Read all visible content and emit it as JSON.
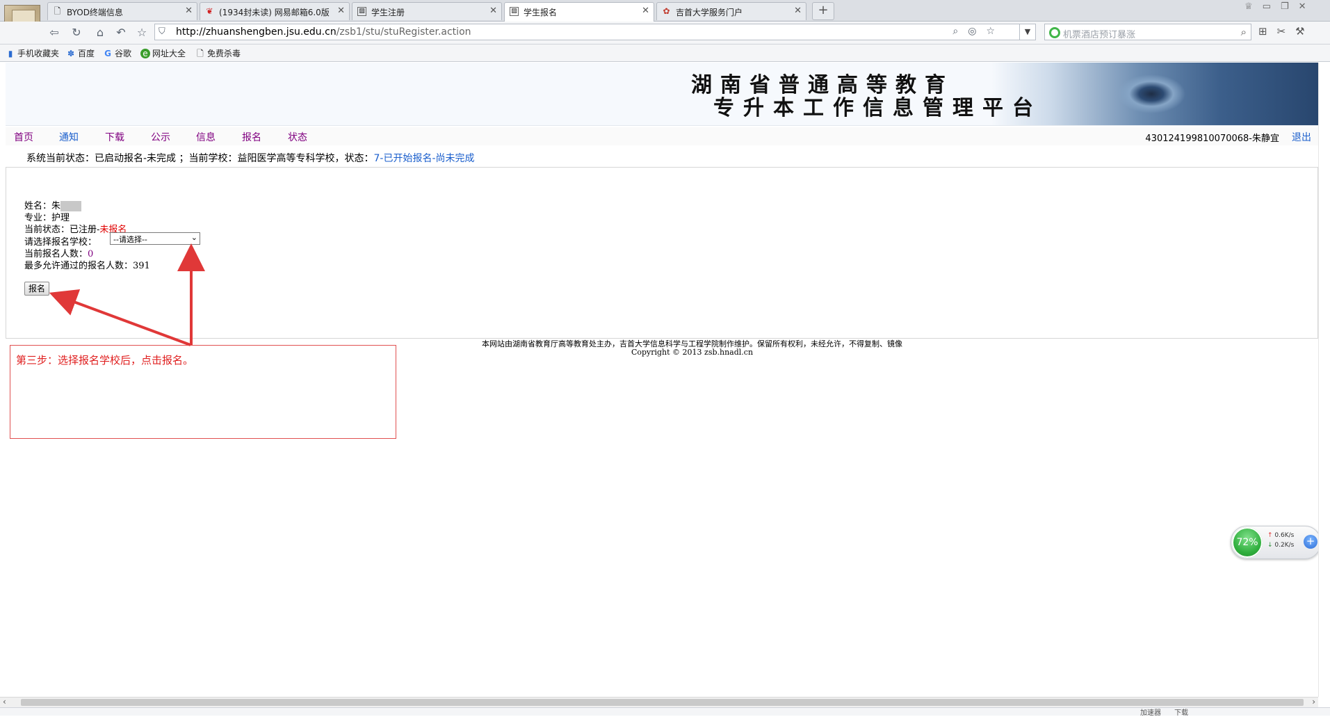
{
  "browser": {
    "tabs": [
      {
        "label": "BYOD终端信息",
        "icon": "page-icon",
        "active": false
      },
      {
        "label": "(1934封未读) 网易邮箱6.0版",
        "icon": "netease-mail-icon",
        "active": false
      },
      {
        "label": "学生注册",
        "icon": "site-favicon",
        "active": false
      },
      {
        "label": "学生报名",
        "icon": "site-favicon",
        "active": true
      },
      {
        "label": "吉首大学服务门户",
        "icon": "portal-favicon",
        "active": false
      }
    ],
    "url_host": "http://zhuanshengben.jsu.edu.cn",
    "url_path": "/zsb1/stu/stuRegister.action",
    "search_placeholder": "机票酒店预订暴涨",
    "bookmarks": [
      {
        "label": "手机收藏夹",
        "icon": "mobile-bookmark-icon"
      },
      {
        "label": "百度",
        "icon": "baidu-icon"
      },
      {
        "label": "谷歌",
        "icon": "google-icon"
      },
      {
        "label": "网址大全",
        "icon": "web-directory-icon"
      },
      {
        "label": "免费杀毒",
        "icon": "page-icon"
      }
    ]
  },
  "banner": {
    "title_line1": "湖南省普通高等教育",
    "title_line2": "专升本工作信息管理平台"
  },
  "menu": {
    "items": [
      "首页",
      "通知",
      "下载",
      "公示",
      "信息",
      "报名",
      "状态"
    ],
    "user": "430124199810070068-朱静宜",
    "logout": "退出"
  },
  "status": {
    "prefix": "系统当前状态：已启动报名-未完成 ；当前学校：益阳医学高等专科学校，状态：",
    "value": "7-已开始报名-尚未完成"
  },
  "form": {
    "name_label": "姓名：",
    "name_value": "朱",
    "major_label": "专业：",
    "major_value": "护理",
    "state_label": "当前状态：",
    "state_value": "已注册-",
    "state_highlight": "未报名",
    "school_label": "请选择报名学校：",
    "school_selected": "--请选择--",
    "count_label": "当前报名人数：",
    "count_value": "0",
    "max_label": "最多允许通过的报名人数：",
    "max_value": "391",
    "submit_label": "报名"
  },
  "footer": {
    "line1": "本网站由湖南省教育厅高等教育处主办，吉首大学信息科学与工程学院制作维护。保留所有权利，未经允许，不得复制、镜像",
    "line2": "Copyright © 2013 zsb.hnadl.cn"
  },
  "annotation": {
    "text": "第三步：选择报名学校后，点击报名。",
    "color": "#e02020"
  },
  "speed_widget": {
    "percent": "72%",
    "up": "0.6K/s",
    "down": "0.2K/s"
  },
  "statusbar": {
    "accelerator": "加速器",
    "download": "下载"
  },
  "colors": {
    "menu_visited": "#800080",
    "menu_link": "#1a5ecc",
    "alert_red": "#e00000"
  }
}
